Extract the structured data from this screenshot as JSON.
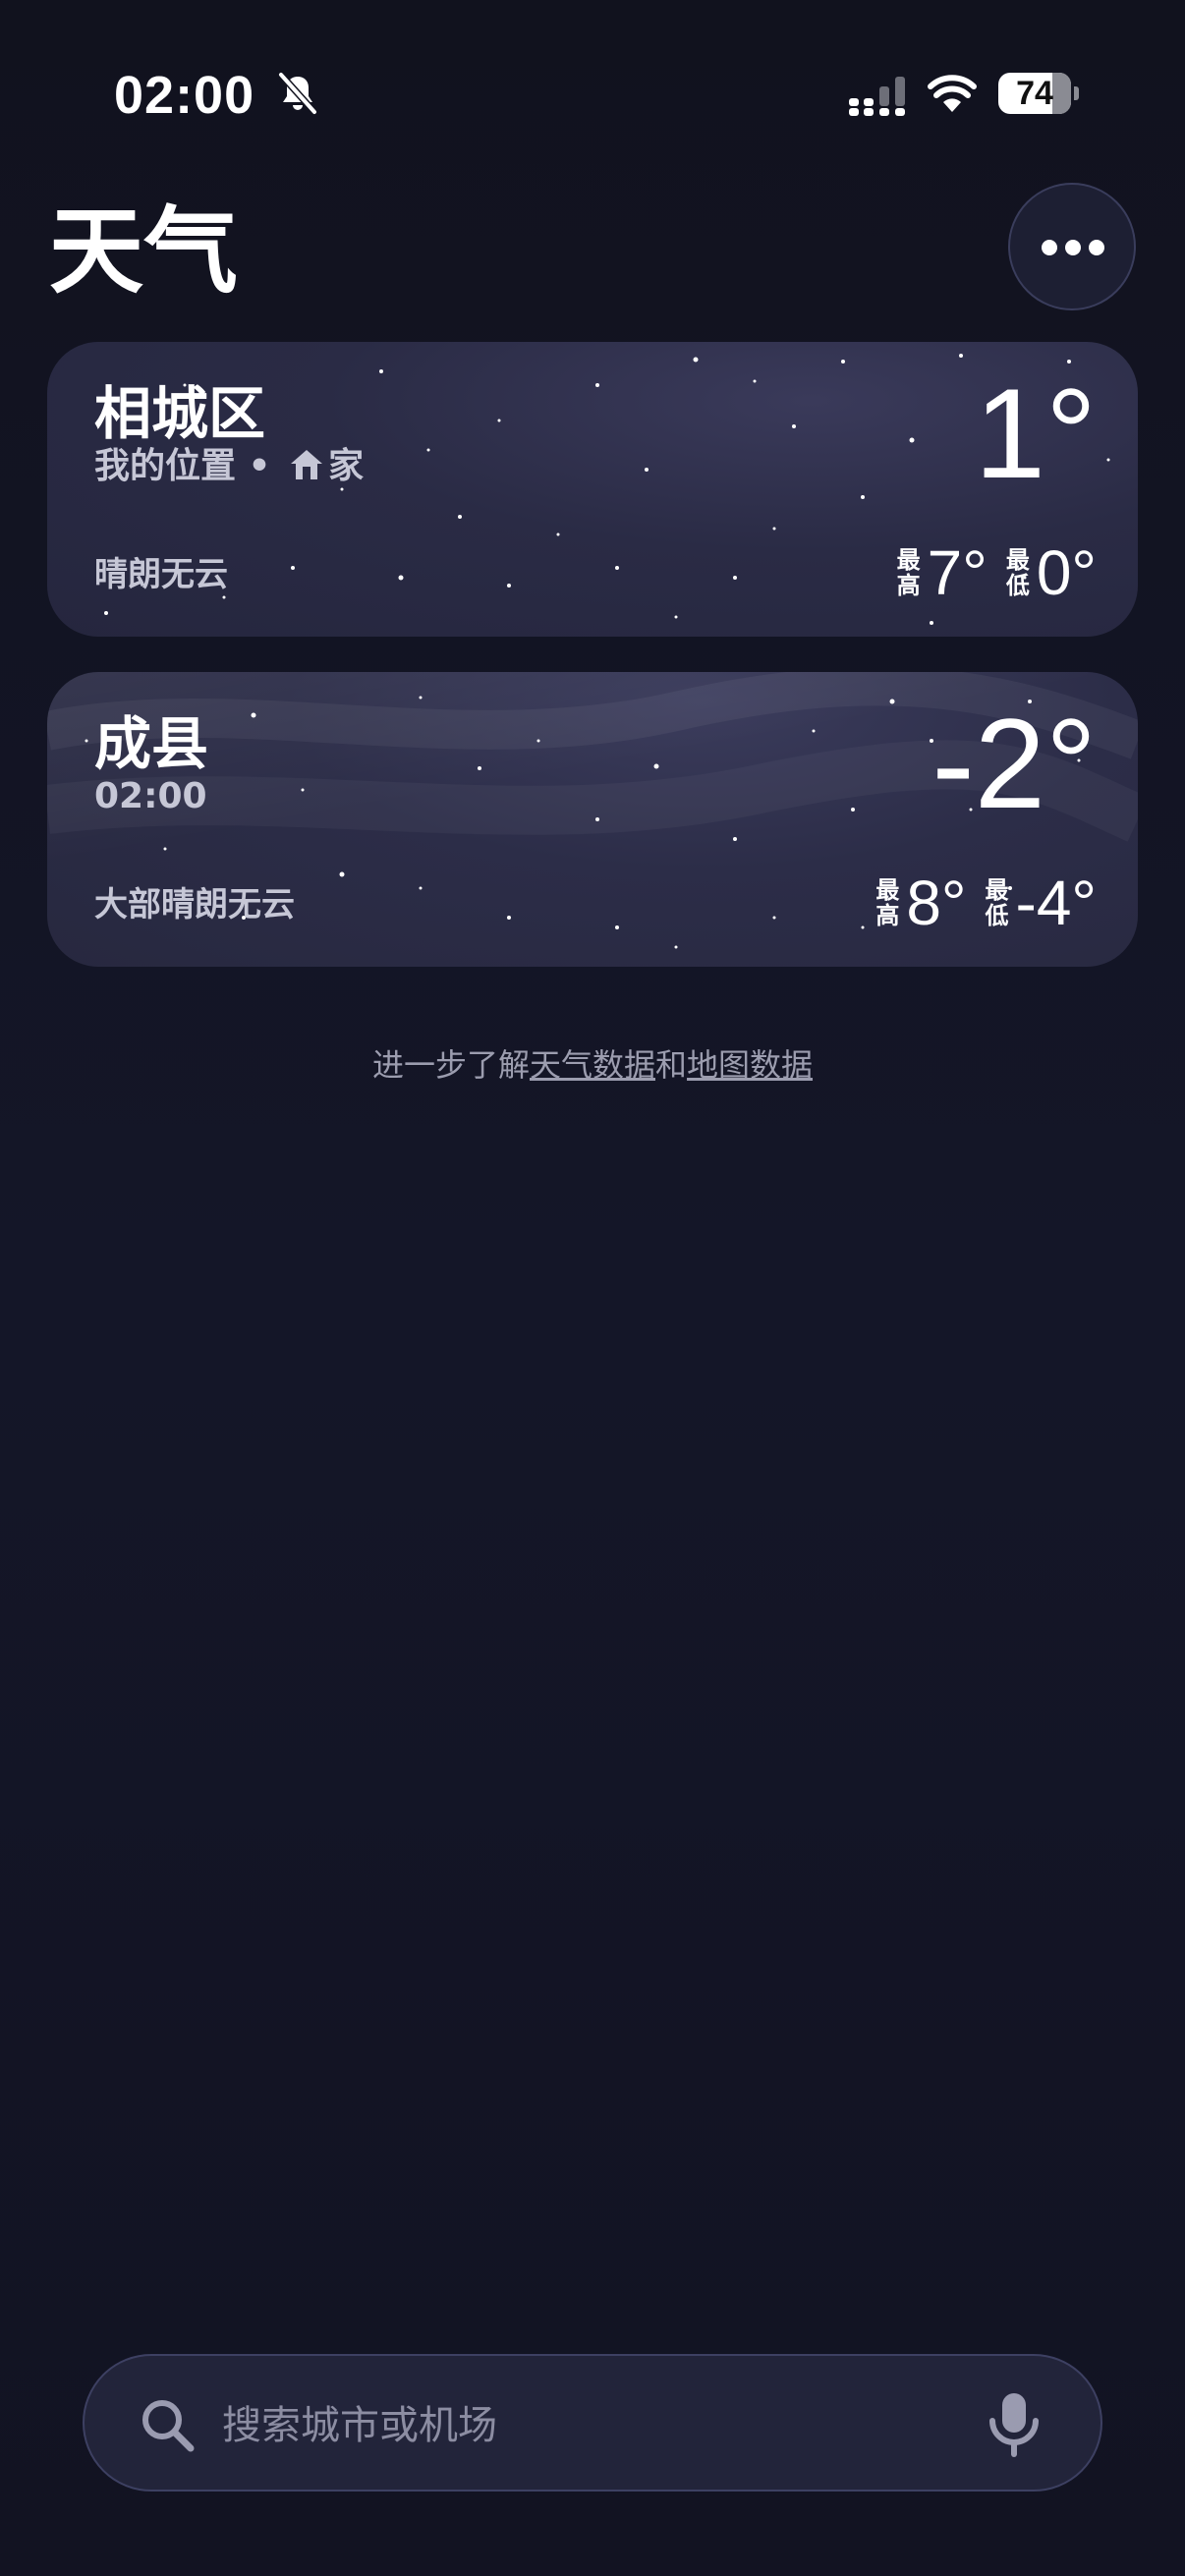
{
  "status_bar": {
    "time": "02:00",
    "battery_level": "74",
    "battery_fraction": 0.74,
    "icons": [
      "bell-slash-icon",
      "cellular-signal-icon",
      "wifi-icon",
      "battery-icon"
    ]
  },
  "header": {
    "title": "天气",
    "more_icon": "ellipsis-icon"
  },
  "cards": [
    {
      "city": "相城区",
      "subtitle_prefix": "我的位置 • ",
      "subtitle_icon": "home-icon",
      "subtitle_suffix": "家",
      "temperature": "1°",
      "condition": "晴朗无云",
      "high_label_1": "最",
      "high_label_2": "高",
      "high": "7°",
      "low_label_1": "最",
      "low_label_2": "低",
      "low": "0°"
    },
    {
      "city": "成县",
      "subtitle": "02:00",
      "temperature": "-2°",
      "condition": "大部晴朗无云",
      "high_label_1": "最",
      "high_label_2": "高",
      "high": "8°",
      "low_label_1": "最",
      "low_label_2": "低",
      "low": "-4°"
    }
  ],
  "data_note": {
    "prefix": "进一步了解",
    "weather_link": "天气数据",
    "joiner": "和",
    "map_link": "地图数据"
  },
  "search": {
    "placeholder": "搜索城市或机场",
    "value": "",
    "search_icon": "magnifier-icon",
    "mic_icon": "microphone-icon"
  },
  "colors": {
    "background": "#12131f",
    "card": "#2a2b45",
    "secondary_text": "#c6c7d6",
    "note_text": "#9c9daf"
  }
}
